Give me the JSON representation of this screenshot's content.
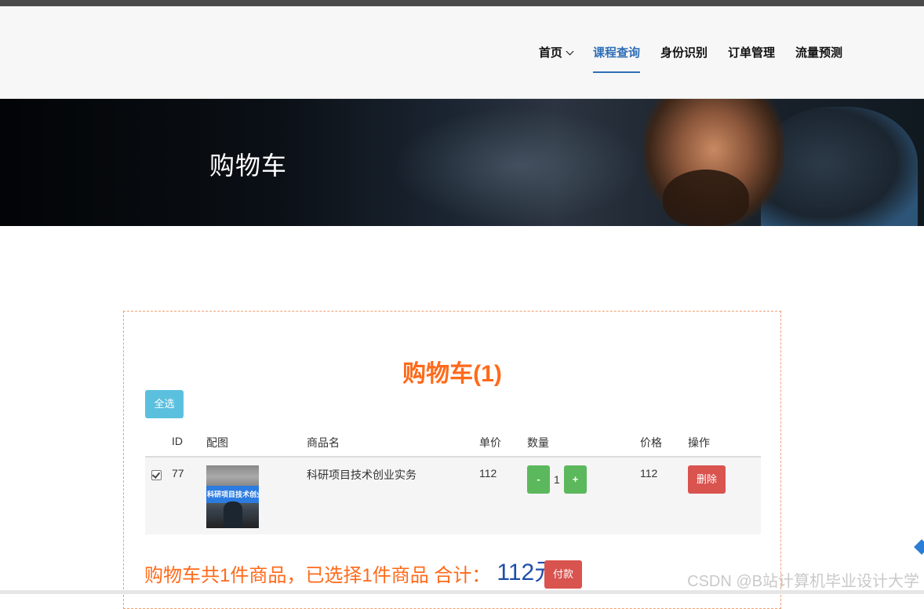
{
  "nav": {
    "items": [
      {
        "label": "首页",
        "has_dropdown": true,
        "active": false
      },
      {
        "label": "课程查询",
        "active": true
      },
      {
        "label": "身份识别",
        "active": false
      },
      {
        "label": "订单管理",
        "active": false
      },
      {
        "label": "流量预测",
        "active": false
      }
    ]
  },
  "banner": {
    "title": "购物车"
  },
  "cart": {
    "title": "购物车(1)",
    "select_all_label": "全选",
    "columns": [
      "ID",
      "配图",
      "商品名",
      "单价",
      "数量",
      "价格",
      "操作"
    ],
    "rows": [
      {
        "checked": true,
        "id": "77",
        "image_text": "科研项目技术创业实务",
        "name": "科研项目技术创业实务",
        "unit_price": "112",
        "minus_label": "-",
        "quantity": "1",
        "plus_label": "+",
        "price": "112",
        "delete_label": "删除"
      }
    ],
    "summary_text": "购物车共1件商品，已选择1件商品 合计：",
    "total": "112元",
    "pay_label": "付款"
  },
  "watermark": "CSDN @B站计算机毕业设计大学",
  "colors": {
    "accent": "#2f6fb7",
    "title_orange": "#ff6a1a",
    "info_button": "#5bc0de",
    "success_button": "#5cb85c",
    "danger_button": "#d9534f",
    "total_blue": "#1f4fa8"
  }
}
